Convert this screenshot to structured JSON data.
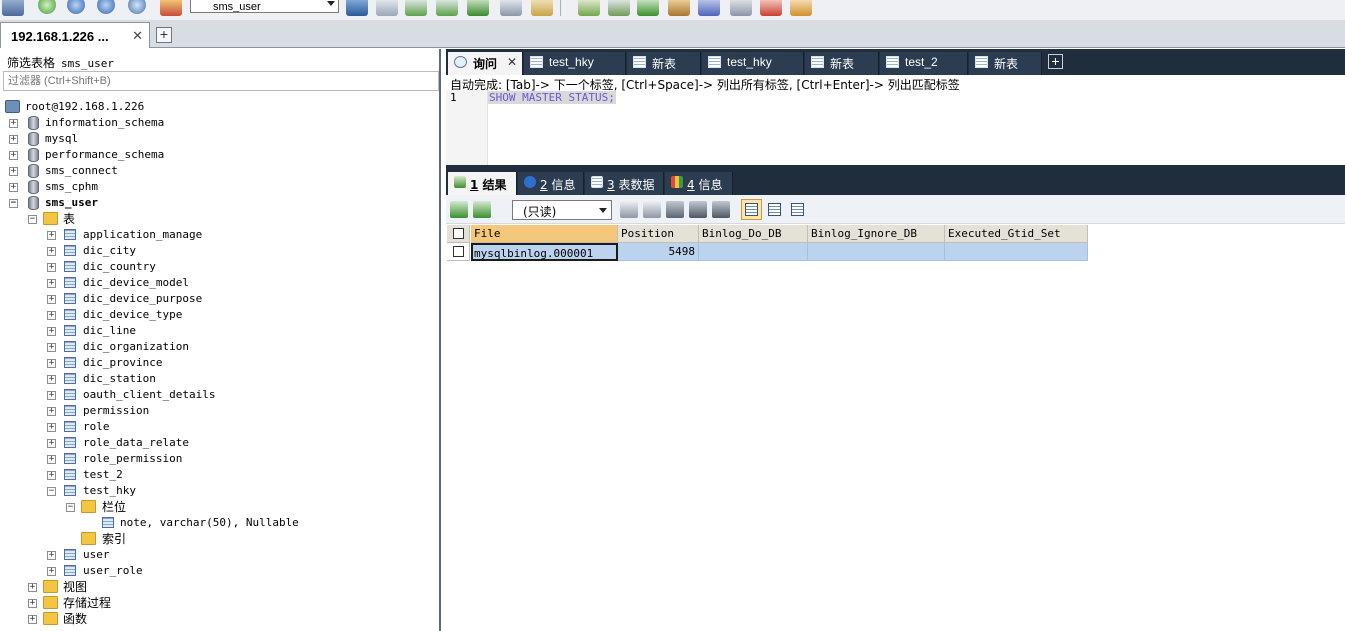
{
  "toolbar": {
    "database_selected": "sms_user",
    "icons": [
      "connect-icon",
      "new-query-icon",
      "execute-icon",
      "execute-all-icon",
      "stop-icon",
      "refresh-icon",
      "database-icon",
      "import-icon",
      "export-icon",
      "backup-icon",
      "restore-icon",
      "schema-sync-icon",
      "data-sync-icon",
      "wizard-icon",
      "scheduler-icon",
      "profiler-icon",
      "query-builder-icon",
      "schema-designer-icon"
    ]
  },
  "connection_tab": {
    "label": "192.168.1.226 ...",
    "close": "✕",
    "add": "+"
  },
  "filter": {
    "label": "筛选表格",
    "table": "sms_user",
    "placeholder": "过滤器 (Ctrl+Shift+B)"
  },
  "tree": {
    "root": "root@192.168.1.226",
    "databases": [
      "information_schema",
      "mysql",
      "performance_schema",
      "sms_connect",
      "sms_cphm"
    ],
    "open_db": "sms_user",
    "tables_folder": "表",
    "tables": [
      "application_manage",
      "dic_city",
      "dic_country",
      "dic_device_model",
      "dic_device_purpose",
      "dic_device_type",
      "dic_line",
      "dic_organization",
      "dic_province",
      "dic_station",
      "oauth_client_details",
      "permission",
      "role",
      "role_data_relate",
      "role_permission",
      "test_2",
      "test_hky"
    ],
    "columns_folder": "栏位",
    "column": "note, varchar(50), Nullable",
    "index_folder": "索引",
    "after_tables": [
      "user",
      "user_role"
    ],
    "folders": [
      "视图",
      "存储过程",
      "函数"
    ]
  },
  "query_tabs": [
    {
      "label": "询问",
      "active": true,
      "close": "✕"
    },
    {
      "label": "test_hky"
    },
    {
      "label": "新表"
    },
    {
      "label": "test_hky"
    },
    {
      "label": "新表"
    },
    {
      "label": "test_2"
    },
    {
      "label": "新表"
    }
  ],
  "query_tab_add": "+",
  "editor": {
    "hint": "自动完成: [Tab]-> 下一个标签, [Ctrl+Space]-> 列出所有标签, [Ctrl+Enter]-> 列出匹配标签",
    "line_number": "1",
    "sql": "SHOW MASTER STATUS;"
  },
  "result_tabs": [
    {
      "num": "1",
      "label": "结果",
      "active": true
    },
    {
      "num": "2",
      "label": "信息"
    },
    {
      "num": "3",
      "label": "表数据"
    },
    {
      "num": "4",
      "label": "信息"
    }
  ],
  "result_toolbar": {
    "mode": "(只读)"
  },
  "grid": {
    "columns": [
      "File",
      "Position",
      "Binlog_Do_DB",
      "Binlog_Ignore_DB",
      "Executed_Gtid_Set"
    ],
    "rows": [
      [
        "mysqlbinlog.000001",
        "5498",
        "",
        "",
        ""
      ]
    ]
  }
}
